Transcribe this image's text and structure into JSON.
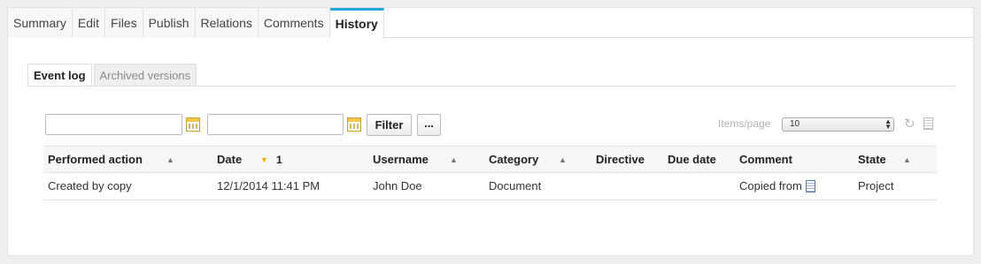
{
  "tabs": [
    {
      "label": "Summary",
      "active": false
    },
    {
      "label": "Edit",
      "active": false
    },
    {
      "label": "Files",
      "active": false
    },
    {
      "label": "Publish",
      "active": false
    },
    {
      "label": "Relations",
      "active": false
    },
    {
      "label": "Comments",
      "active": false
    },
    {
      "label": "History",
      "active": true
    }
  ],
  "subtabs": [
    {
      "label": "Event log",
      "active": true
    },
    {
      "label": "Archived versions",
      "active": false
    }
  ],
  "filter": {
    "date_from_value": "",
    "date_to_value": "",
    "filter_label": "Filter",
    "more_label": "...",
    "items_per_page_label": "Items/page",
    "items_per_page_value": "10"
  },
  "table": {
    "columns": [
      "Performed action",
      "Date",
      "Username",
      "Category",
      "Directive",
      "Due date",
      "Comment",
      "State"
    ],
    "sort_index": "1",
    "rows": [
      [
        "Created by copy",
        "12/1/2014 11:41 PM",
        "John Doe",
        "Document",
        "",
        "",
        "Copied from",
        "Project"
      ]
    ]
  },
  "colors": {
    "accent": "#23a6e0",
    "sort_active": "#f0b400"
  }
}
